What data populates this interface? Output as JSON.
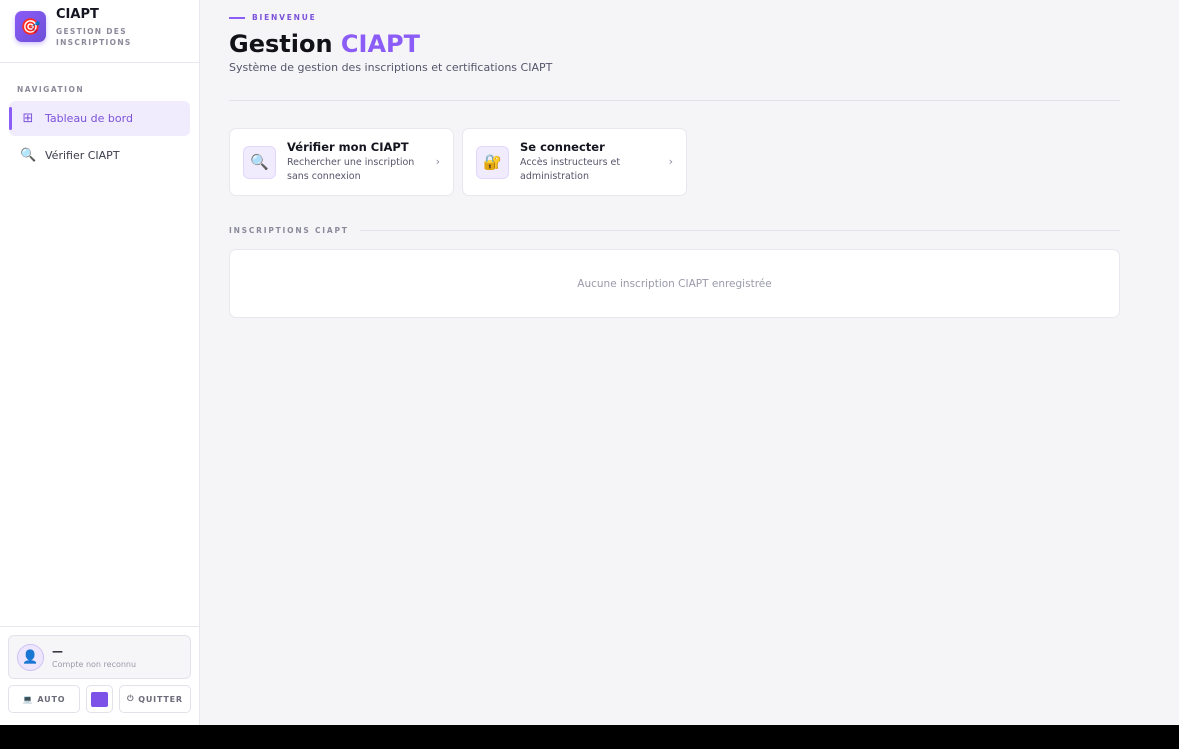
{
  "brand": {
    "logo_icon": "🎯",
    "title": "CIAPT",
    "subtitle": "GESTION DES INSCRIPTIONS"
  },
  "sidebar": {
    "section_label": "NAVIGATION",
    "items": [
      {
        "label": "Tableau de bord",
        "icon": "⊞",
        "icon_name": "dashboard-grid-icon",
        "active": true
      },
      {
        "label": "Vérifier CIAPT",
        "icon": "🔍",
        "icon_name": "search-icon",
        "active": false
      }
    ]
  },
  "user": {
    "avatar_icon": "👤",
    "name": "—",
    "status": "Compte non reconnu"
  },
  "footer": {
    "theme_icon": "💻",
    "theme_label": "AUTO",
    "accent_color": "#7c52e8",
    "quit_icon": "⏻",
    "quit_label": "QUITTER"
  },
  "main": {
    "eyebrow": "BIENVENUE",
    "title_prefix": "Gestion",
    "title_accent": "CIAPT",
    "subtitle": "Système de gestion des inscriptions et certifications CIAPT",
    "cards": [
      {
        "icon": "🔍",
        "title": "Vérifier mon CIAPT",
        "desc": "Rechercher une inscription sans connexion",
        "chevron": "›"
      },
      {
        "icon": "🔐",
        "title": "Se connecter",
        "desc": "Accès instructeurs et administration",
        "chevron": "›"
      }
    ],
    "section_title": "INSCRIPTIONS CIAPT",
    "empty_message": "Aucune inscription CIAPT enregistrée"
  }
}
